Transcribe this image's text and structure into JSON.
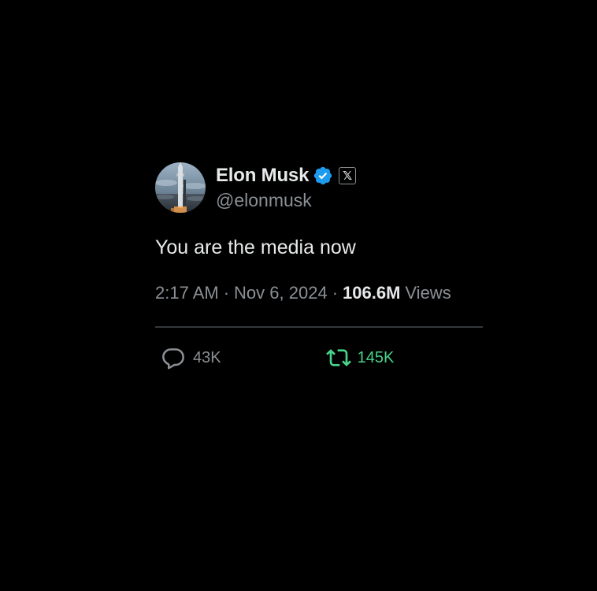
{
  "author": {
    "display_name": "Elon Musk",
    "handle": "@elonmusk",
    "verified_icon": "verified-badge-icon",
    "affiliate_badge_label": "𝕏",
    "avatar_icon": "starship-rocket-avatar"
  },
  "tweet": {
    "text": "You are the media now",
    "time": "2:17 AM",
    "separator": "·",
    "date": "Nov 6, 2024",
    "views_count": "106.6M",
    "views_label": "Views"
  },
  "actions": {
    "replies": "43K",
    "reposts": "145K",
    "reply_icon": "reply-bubble-icon",
    "repost_icon": "repost-icon"
  },
  "colors": {
    "background": "#000000",
    "text_primary": "#e7e9ea",
    "text_secondary": "#8b9095",
    "verified_blue": "#1d9bf0",
    "repost_green": "#48d38a",
    "divider": "#34383c"
  }
}
